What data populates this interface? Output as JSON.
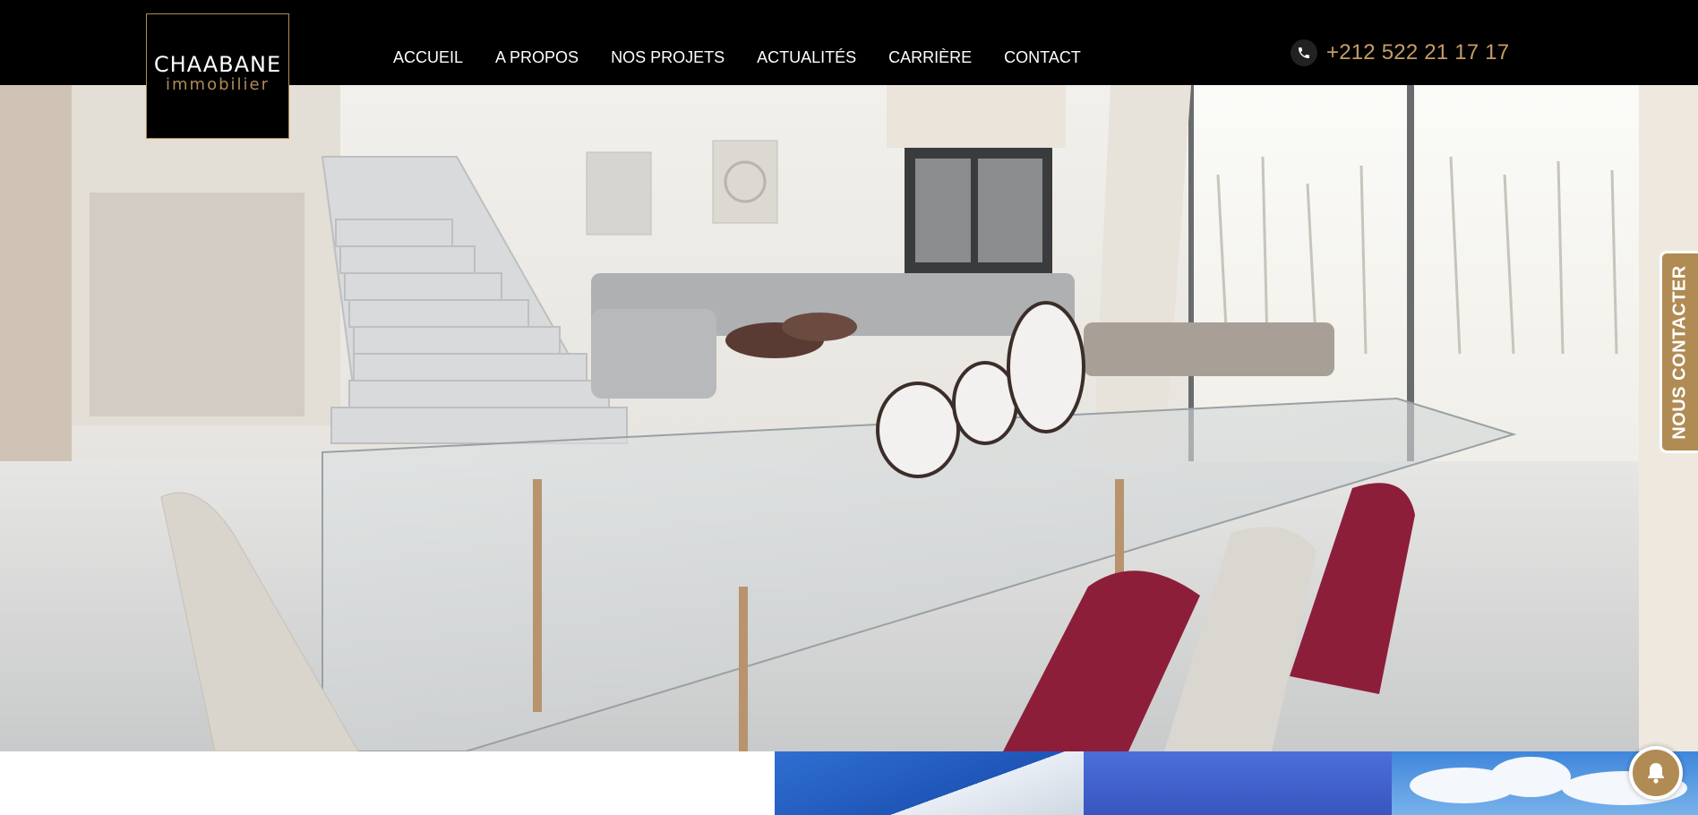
{
  "logo": {
    "main": "CHAABANE",
    "sub": "immobilier"
  },
  "nav": {
    "items": [
      {
        "label": "ACCUEIL"
      },
      {
        "label": "A PROPOS"
      },
      {
        "label": "NOS PROJETS"
      },
      {
        "label": "ACTUALITÉS"
      },
      {
        "label": "CARRIÈRE"
      },
      {
        "label": "CONTACT"
      }
    ]
  },
  "phone": {
    "number": "+212 522 21 17 17",
    "icon": "phone-icon"
  },
  "side_tab": {
    "label": "NOUS CONTACTER"
  },
  "bell": {
    "icon": "bell-icon"
  },
  "colors": {
    "brand_gold": "#b08b54",
    "header_bg": "#000000",
    "phone_text": "#c69c64"
  }
}
